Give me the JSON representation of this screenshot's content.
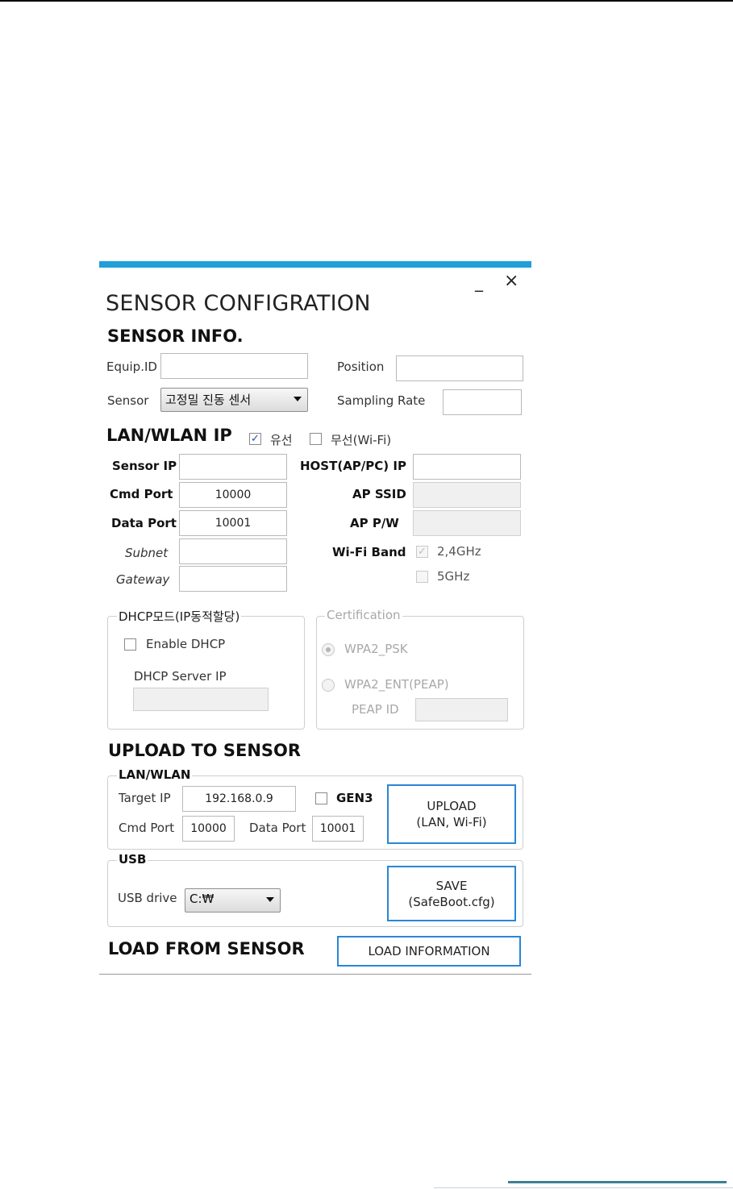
{
  "window": {
    "title": "SENSOR CONFIGRATION",
    "minimize_label": "_",
    "close_label": "×"
  },
  "sensor_info": {
    "heading": "SENSOR INFO.",
    "equip_id_label": "Equip.ID",
    "equip_id_value": "",
    "position_label": "Position",
    "position_value": "",
    "sensor_label": "Sensor",
    "sensor_selected": "고정밀 진동 센서",
    "sampling_rate_label": "Sampling Rate",
    "sampling_rate_value": ""
  },
  "lan_wlan": {
    "heading": "LAN/WLAN IP",
    "wired_label": "유선",
    "wired_checked": true,
    "wireless_label": "무선(Wi-Fi)",
    "wireless_checked": false,
    "sensor_ip_label": "Sensor IP",
    "sensor_ip_value": "",
    "cmd_port_label": "Cmd Port",
    "cmd_port_value": "10000",
    "data_port_label": "Data Port",
    "data_port_value": "10001",
    "subnet_label": "Subnet",
    "subnet_value": "",
    "gateway_label": "Gateway",
    "gateway_value": "",
    "host_ip_label": "HOST(AP/PC) IP",
    "host_ip_value": "",
    "ap_ssid_label": "AP SSID",
    "ap_ssid_value": "",
    "ap_pw_label": "AP P/W",
    "ap_pw_value": "",
    "wifi_band_label": "Wi-Fi Band",
    "band_24_label": "2,4GHz",
    "band_24_checked": true,
    "band_5_label": "5GHz",
    "band_5_checked": false
  },
  "dhcp": {
    "legend": "DHCP모드(IP동적할당)",
    "enable_label": "Enable DHCP",
    "enable_checked": false,
    "server_ip_label": "DHCP Server IP",
    "server_ip_value": ""
  },
  "certification": {
    "legend": "Certification",
    "wpa2_psk_label": "WPA2_PSK",
    "wpa2_ent_label": "WPA2_ENT(PEAP)",
    "selected": "WPA2_PSK",
    "peap_id_label": "PEAP ID",
    "peap_id_value": ""
  },
  "upload": {
    "heading": "UPLOAD TO SENSOR",
    "lan_legend": "LAN/WLAN",
    "target_ip_label": "Target IP",
    "target_ip_value": "192.168.0.9",
    "gen3_label": "GEN3",
    "gen3_checked": false,
    "cmd_port_label": "Cmd Port",
    "cmd_port_value": "10000",
    "data_port_label": "Data Port",
    "data_port_value": "10001",
    "upload_button_line1": "UPLOAD",
    "upload_button_line2": "(LAN, Wi-Fi)",
    "usb_legend": "USB",
    "usb_drive_label": "USB drive",
    "usb_drive_selected": "C:₩",
    "save_button_line1": "SAVE",
    "save_button_line2": "(SafeBoot.cfg)"
  },
  "load": {
    "heading": "LOAD FROM SENSOR",
    "button_label": "LOAD INFORMATION"
  },
  "colors": {
    "accent": "#1fa0d8",
    "button_border": "#2a86d6",
    "footer_bar": "#3f7f92"
  }
}
